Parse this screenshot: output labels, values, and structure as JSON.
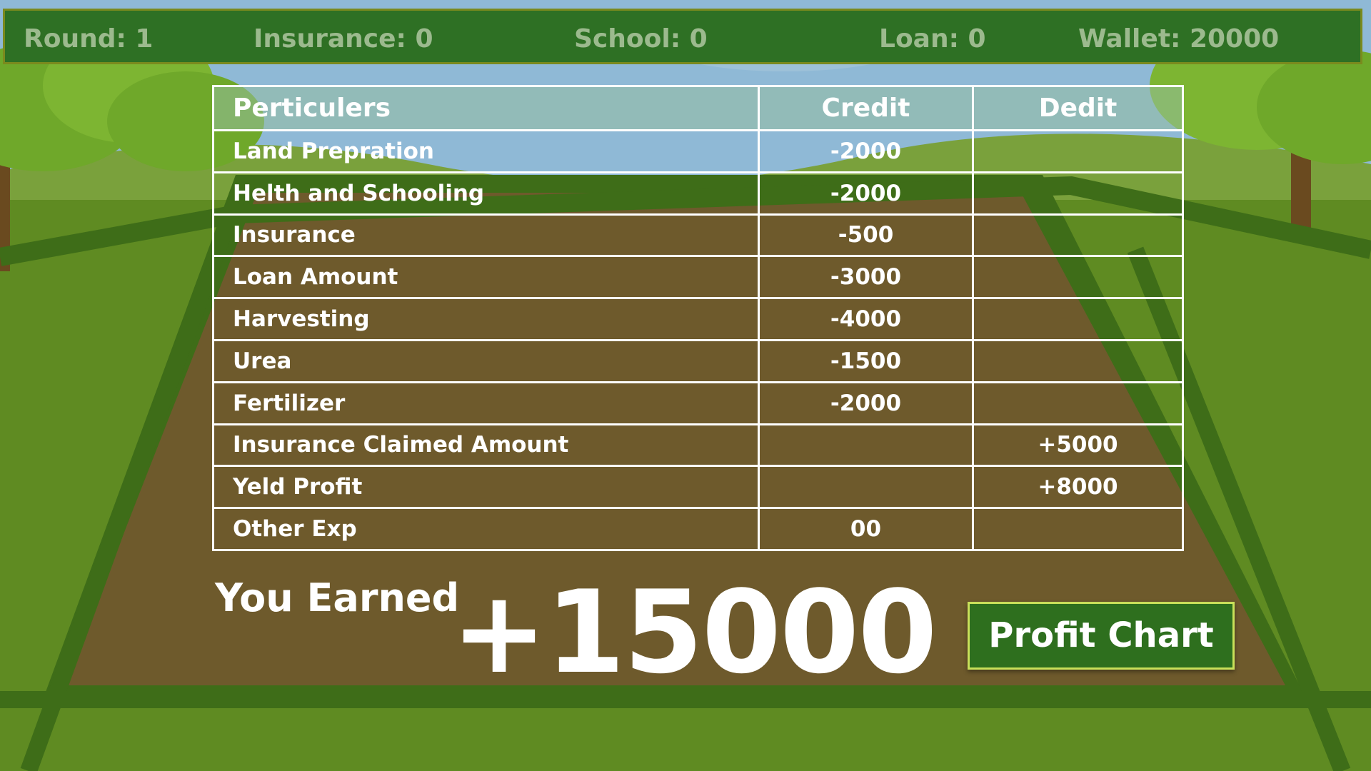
{
  "hud": {
    "round": "Round: 1",
    "insurance": "Insurance: 0",
    "school": "School: 0",
    "loan": "Loan: 0",
    "wallet": "Wallet: 20000"
  },
  "table": {
    "headers": {
      "particulars": "Perticulers",
      "credit": "Credit",
      "debit": "Dedit"
    },
    "rows": [
      {
        "label": "Land Prepration",
        "credit": "-2000",
        "debit": ""
      },
      {
        "label": "Helth and Schooling",
        "credit": "-2000",
        "debit": ""
      },
      {
        "label": "Insurance",
        "credit": "-500",
        "debit": ""
      },
      {
        "label": "Loan Amount",
        "credit": "-3000",
        "debit": ""
      },
      {
        "label": "Harvesting",
        "credit": "-4000",
        "debit": ""
      },
      {
        "label": "Urea",
        "credit": "-1500",
        "debit": ""
      },
      {
        "label": "Fertilizer",
        "credit": "-2000",
        "debit": ""
      },
      {
        "label": "Insurance Claimed Amount",
        "credit": "",
        "debit": "+5000"
      },
      {
        "label": "Yeld Profit",
        "credit": "",
        "debit": "+8000"
      },
      {
        "label": "Other Exp",
        "credit": "00",
        "debit": ""
      }
    ]
  },
  "summary": {
    "earned_label": "You Earned",
    "earned_value": "+15000"
  },
  "buttons": {
    "profit_chart": "Profit Chart"
  },
  "colors": {
    "hud_bg": "#2e7024",
    "soil": "#6e5a2c",
    "field_border": "#3e6d18",
    "button_bg": "#2e6f1e"
  }
}
